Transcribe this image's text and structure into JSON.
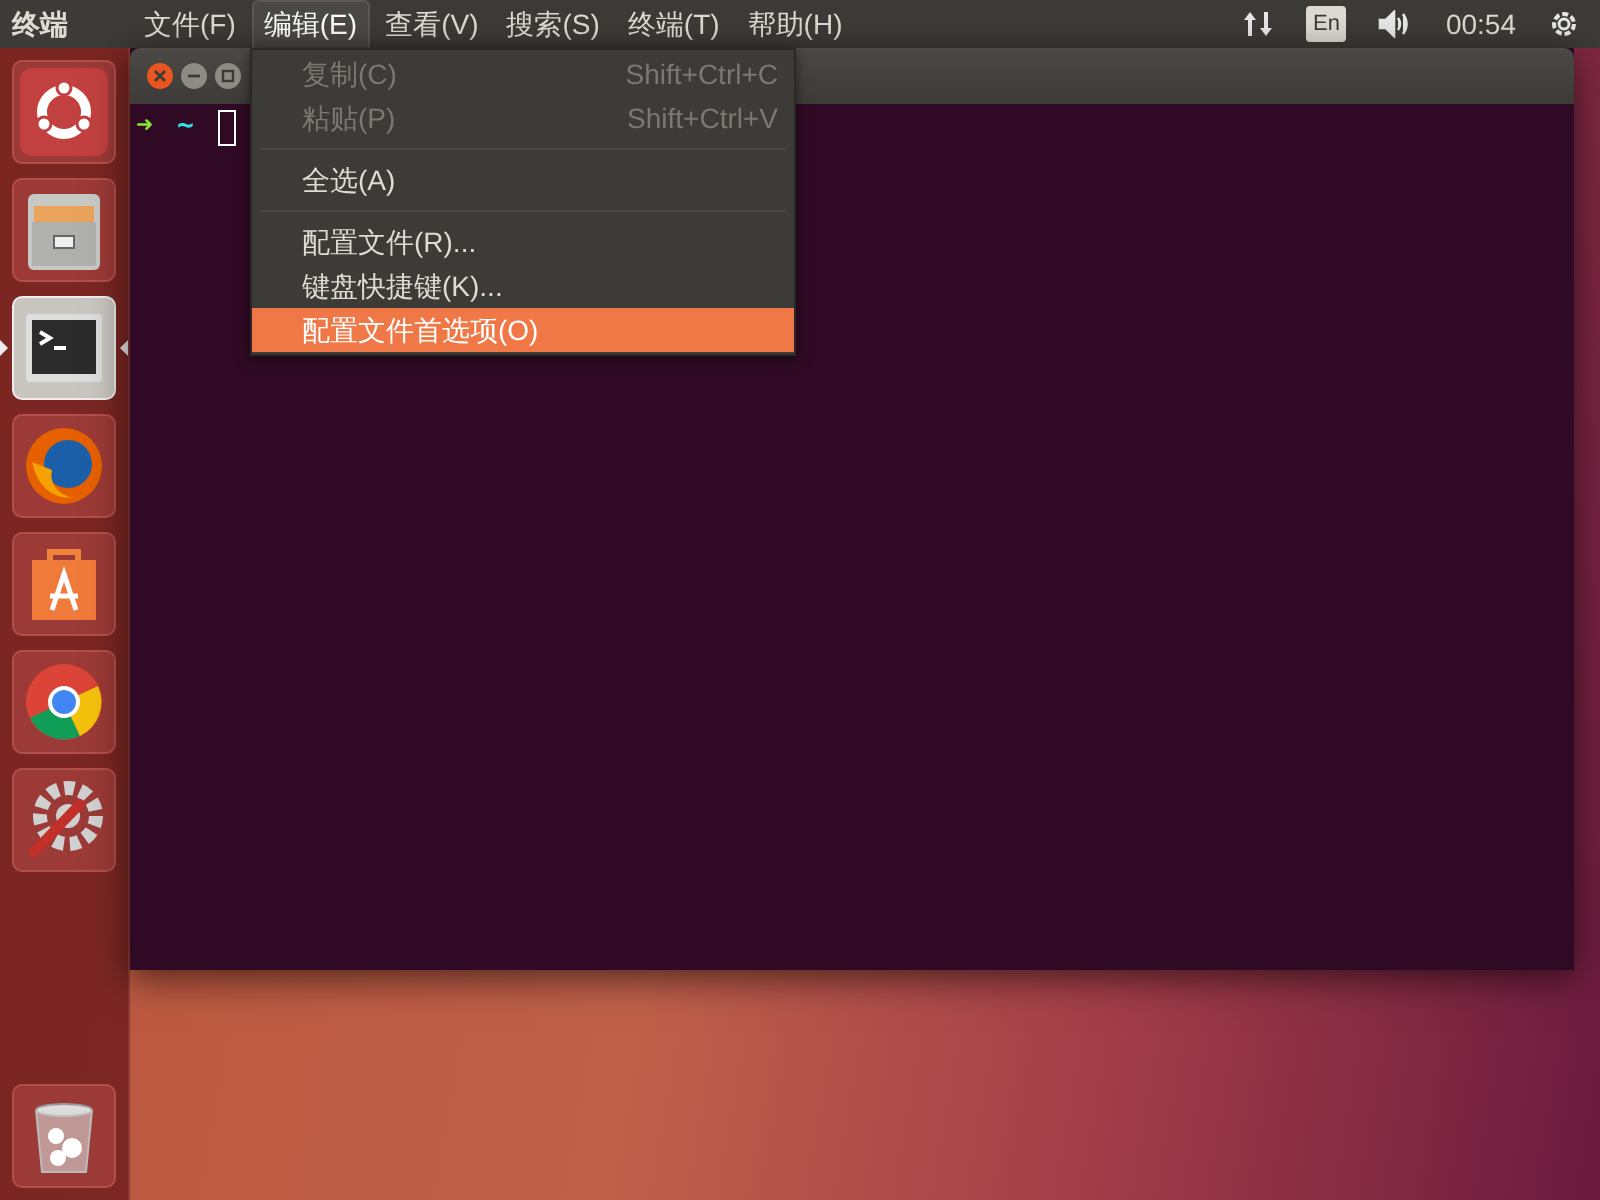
{
  "top_panel": {
    "app_title": "终端",
    "menus": [
      {
        "label": "文件(F)",
        "selected": false
      },
      {
        "label": "编辑(E)",
        "selected": true
      },
      {
        "label": "查看(V)",
        "selected": false
      },
      {
        "label": "搜索(S)",
        "selected": false
      },
      {
        "label": "终端(T)",
        "selected": false
      },
      {
        "label": "帮助(H)",
        "selected": false
      }
    ],
    "keyboard": "En",
    "clock": "00:54"
  },
  "launcher": {
    "items": [
      {
        "kind": "ubuntu",
        "focused": false
      },
      {
        "kind": "files",
        "focused": false
      },
      {
        "kind": "terminal",
        "focused": true
      },
      {
        "kind": "firefox",
        "focused": false
      },
      {
        "kind": "software",
        "focused": false
      },
      {
        "kind": "chrome",
        "focused": false
      },
      {
        "kind": "settings",
        "focused": false
      }
    ],
    "trash": {
      "kind": "trash",
      "focused": false
    }
  },
  "terminal": {
    "prompt_arrow": "➜",
    "prompt_dir": "~"
  },
  "edit_menu": {
    "items": [
      {
        "kind": "item",
        "label": "复制(C)",
        "shortcut": "Shift+Ctrl+C",
        "disabled": true,
        "selected": false
      },
      {
        "kind": "item",
        "label": "粘贴(P)",
        "shortcut": "Shift+Ctrl+V",
        "disabled": true,
        "selected": false
      },
      {
        "kind": "separator"
      },
      {
        "kind": "item",
        "label": "全选(A)",
        "disabled": false,
        "selected": false
      },
      {
        "kind": "separator"
      },
      {
        "kind": "item",
        "label": "配置文件(R)...",
        "disabled": false,
        "selected": false
      },
      {
        "kind": "item",
        "label": "键盘快捷键(K)...",
        "disabled": false,
        "selected": false
      },
      {
        "kind": "item",
        "label": "配置文件首选项(O)",
        "disabled": false,
        "selected": true
      }
    ]
  }
}
